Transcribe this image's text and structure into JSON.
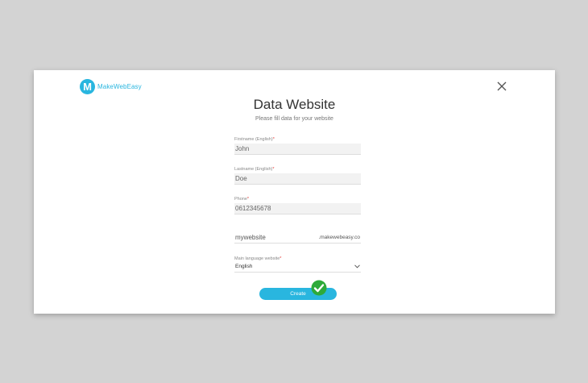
{
  "brand": {
    "name": "MakeWebEasy",
    "logo_letter": "M",
    "color": "#29b6df"
  },
  "dialog": {
    "title": "Data Website",
    "subtitle": "Please fill data for your website",
    "close_icon": "close-icon"
  },
  "form": {
    "firstname": {
      "label": "Firstname (English)",
      "required": "*",
      "value": "John"
    },
    "lastname": {
      "label": "Lastname (English)",
      "required": "*",
      "value": "Doe"
    },
    "phone": {
      "label": "Phone",
      "required": "*",
      "value": "0612345678"
    },
    "website": {
      "value": "mywebsite",
      "suffix": ".makewebeasy.co"
    },
    "language": {
      "label": "Main language website",
      "required": "*",
      "value": "English"
    }
  },
  "create_button": {
    "label": "Create",
    "icon": "check-icon"
  },
  "colors": {
    "accent": "#29b6df",
    "required": "#e53935",
    "success": "#2eaa3a"
  }
}
